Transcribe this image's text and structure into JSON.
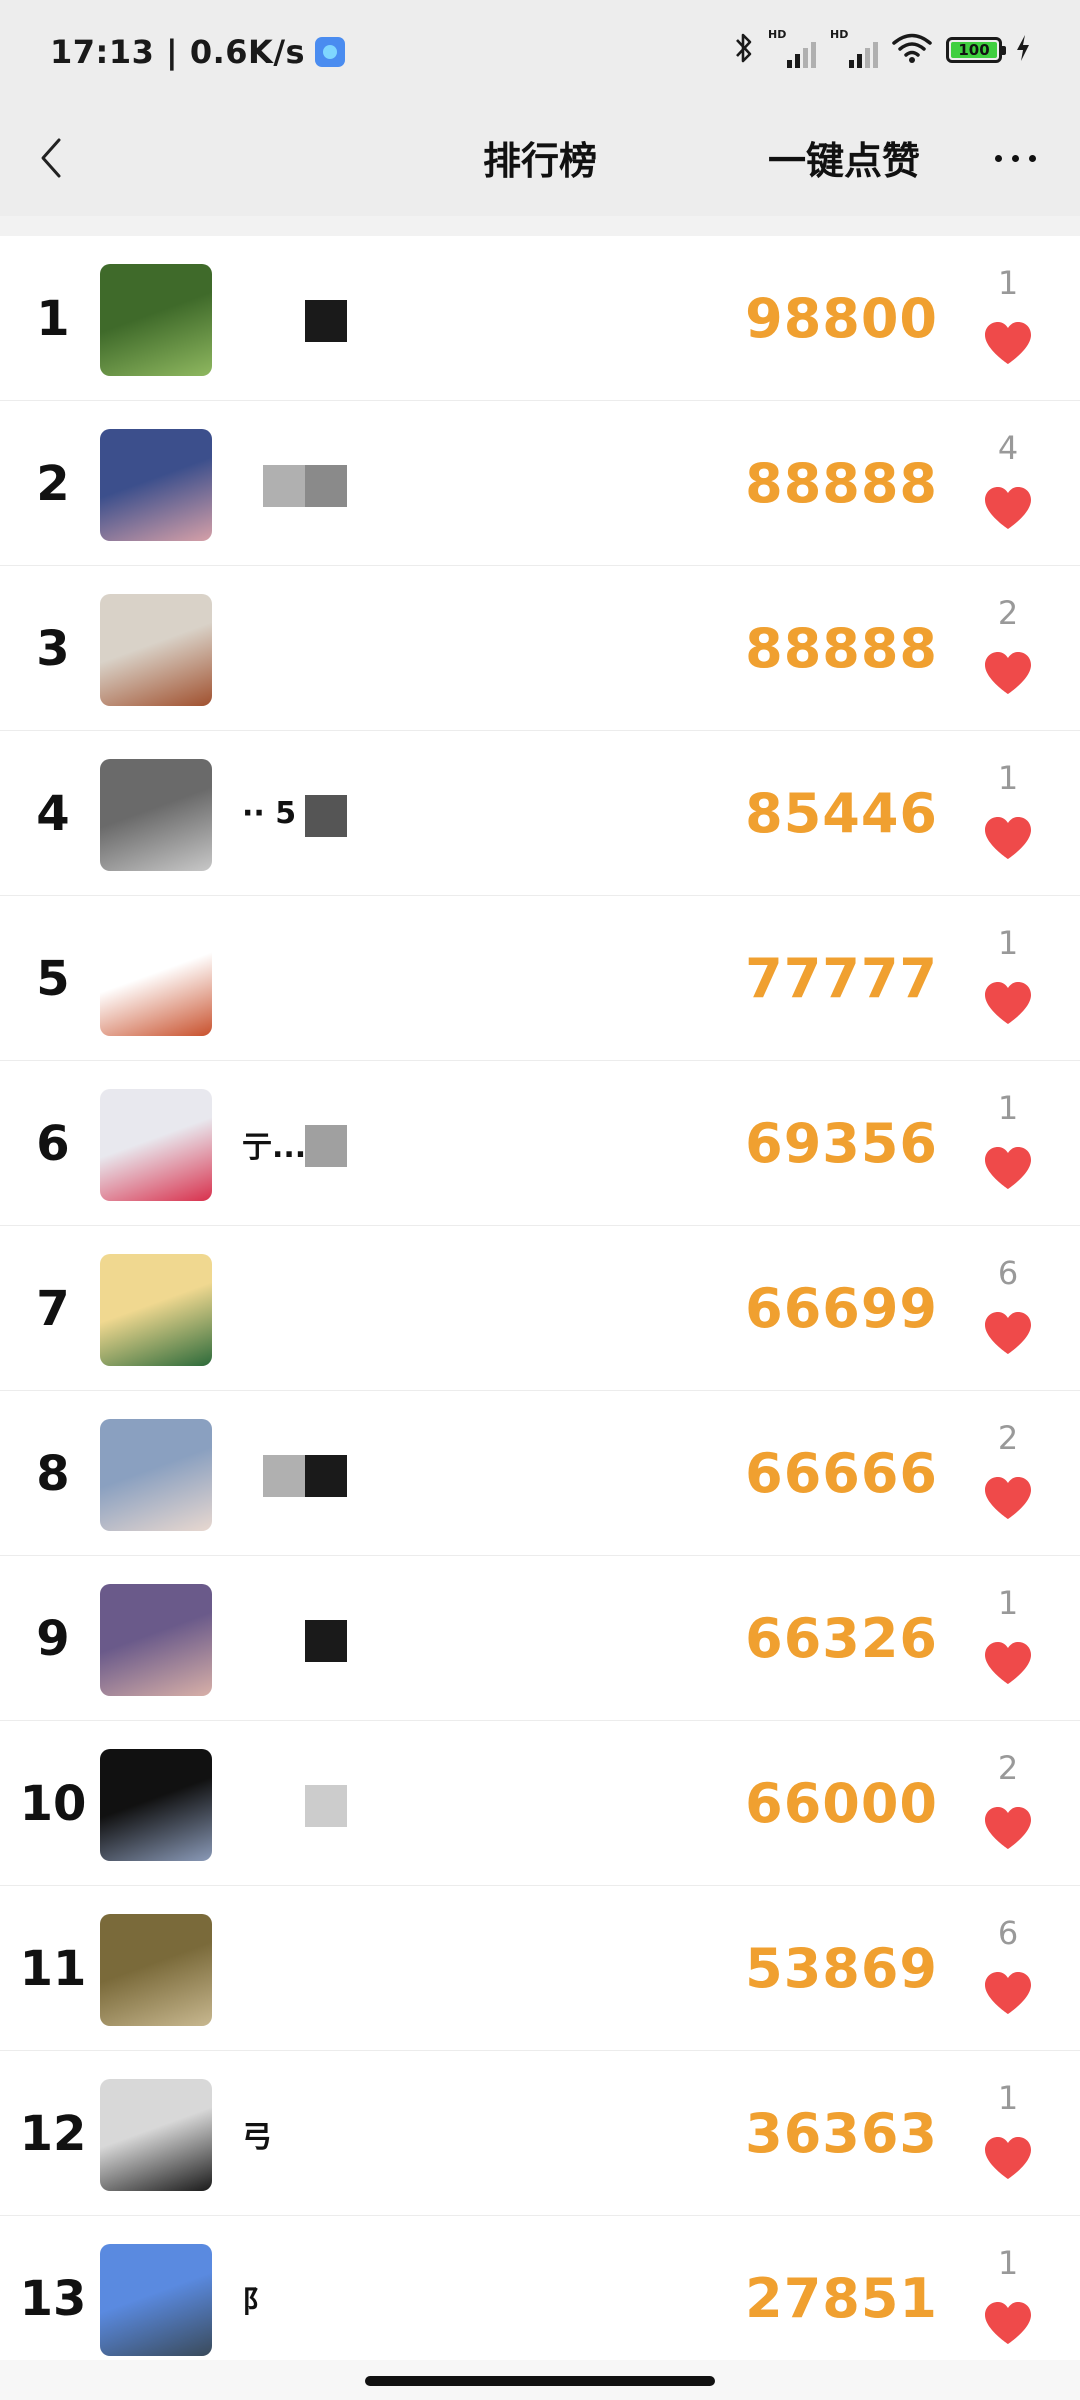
{
  "status_bar": {
    "time_speed": "17:13 | 0.6K/s",
    "hd1": "HD",
    "hd2": "HD",
    "battery": "100",
    "icons": [
      "bluetooth-icon",
      "signal-icon",
      "signal-icon",
      "wifi-icon",
      "battery-icon",
      "charging-icon"
    ]
  },
  "nav": {
    "title": "排行榜",
    "like_all_label": "一键点赞",
    "back_icon": "chevron-left-icon",
    "more_icon": "more-icon"
  },
  "colors": {
    "score": "#f0a030",
    "heart": "#ef4a4a",
    "like_count": "#999999",
    "nav_bg": "#ededed"
  },
  "rows": [
    {
      "rank": "1",
      "name": "",
      "score": "98800",
      "likes": "1",
      "avatar_bg": [
        "#3f6a2a",
        "#8fb860"
      ],
      "mosaic": [
        "#1a1a1a"
      ]
    },
    {
      "rank": "2",
      "name": "",
      "score": "88888",
      "likes": "4",
      "avatar_bg": [
        "#3c4f8c",
        "#d6a0a8"
      ],
      "mosaic": [
        "#b0b0b0",
        "#8a8a8a"
      ]
    },
    {
      "rank": "3",
      "name": "",
      "score": "88888",
      "likes": "2",
      "avatar_bg": [
        "#d9d2c8",
        "#a0502e"
      ],
      "mosaic": []
    },
    {
      "rank": "4",
      "name": "·· 5",
      "score": "85446",
      "likes": "1",
      "avatar_bg": [
        "#6a6a6a",
        "#c8c8c8"
      ],
      "mosaic": [
        "#555555"
      ]
    },
    {
      "rank": "5",
      "name": "",
      "score": "77777",
      "likes": "1",
      "avatar_bg": [
        "#ffffff",
        "#c8502c"
      ],
      "mosaic": []
    },
    {
      "rank": "6",
      "name": "亍...",
      "score": "69356",
      "likes": "1",
      "avatar_bg": [
        "#e8e8ee",
        "#d8304c"
      ],
      "mosaic": [
        "#a0a0a0"
      ]
    },
    {
      "rank": "7",
      "name": "",
      "score": "66699",
      "likes": "6",
      "avatar_bg": [
        "#f0d890",
        "#2c6a3a"
      ],
      "mosaic": []
    },
    {
      "rank": "8",
      "name": "",
      "score": "66666",
      "likes": "2",
      "avatar_bg": [
        "#8aa0c0",
        "#e8d8d0"
      ],
      "mosaic": [
        "#b0b0b0",
        "#1a1a1a"
      ]
    },
    {
      "rank": "9",
      "name": "",
      "score": "66326",
      "likes": "1",
      "avatar_bg": [
        "#6a5a8a",
        "#d8b0a8"
      ],
      "mosaic": [
        "#1a1a1a"
      ]
    },
    {
      "rank": "10",
      "name": "",
      "score": "66000",
      "likes": "2",
      "avatar_bg": [
        "#111111",
        "#8a9ab8"
      ],
      "mosaic": [
        "#cccccc"
      ]
    },
    {
      "rank": "11",
      "name": "",
      "score": "53869",
      "likes": "6",
      "avatar_bg": [
        "#7a6a3a",
        "#c8b890"
      ],
      "mosaic": []
    },
    {
      "rank": "12",
      "name": "弓",
      "score": "36363",
      "likes": "1",
      "avatar_bg": [
        "#d8d8d8",
        "#1a1a1a"
      ],
      "mosaic": []
    },
    {
      "rank": "13",
      "name": "阝",
      "score": "27851",
      "likes": "1",
      "avatar_bg": [
        "#5a8ae0",
        "#3a4a5a"
      ],
      "mosaic": []
    }
  ]
}
